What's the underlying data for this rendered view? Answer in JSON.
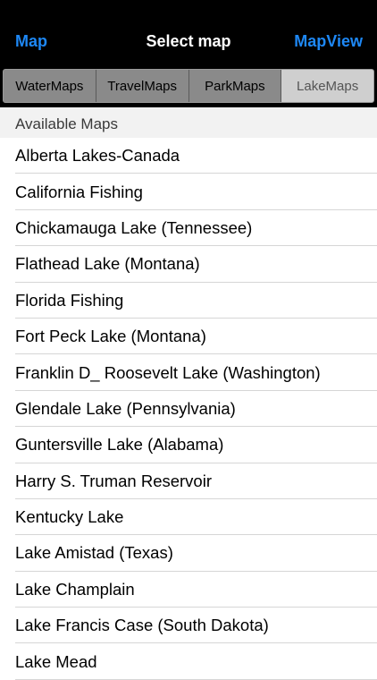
{
  "nav": {
    "back_label": "Map",
    "title": "Select map",
    "right_label": "MapView"
  },
  "tabs": [
    "WaterMaps",
    "TravelMaps",
    "ParkMaps",
    "LakeMaps"
  ],
  "active_tab": "LakeMaps",
  "section": {
    "header": "Available Maps"
  },
  "maps": [
    "Alberta Lakes-Canada",
    "California Fishing",
    "Chickamauga Lake (Tennessee)",
    "Flathead Lake (Montana)",
    "Florida Fishing",
    "Fort Peck Lake (Montana)",
    "Franklin D_ Roosevelt Lake (Washington)",
    "Glendale Lake (Pennsylvania)",
    "Guntersville Lake (Alabama)",
    "Harry S. Truman Reservoir",
    "Kentucky Lake",
    "Lake Amistad (Texas)",
    "Lake Champlain",
    "Lake Francis Case (South Dakota)",
    "Lake Mead"
  ],
  "colors": {
    "accent": "#1e88f5",
    "nav_bg": "#000000",
    "segment_bg": "#8a8a8a",
    "segment_active_bg": "#cfcfcf"
  }
}
